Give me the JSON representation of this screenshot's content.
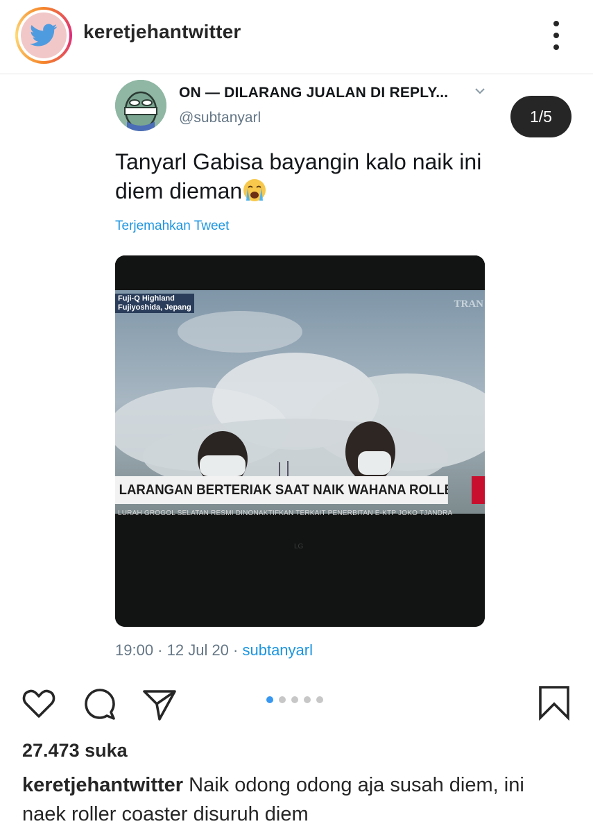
{
  "header": {
    "username": "keretjehantwitter",
    "avatar_icon": "twitter-bird-icon",
    "more_icon": "more-vertical-icon"
  },
  "carousel": {
    "counter": "1/5",
    "dots_total": 5,
    "active_index": 0
  },
  "tweet": {
    "display_name": "ON — DILARANG JUALAN DI REPLY...",
    "handle": "@subtanyarl",
    "text": "Tanyarl Gabisa bayangin kalo naik ini diem dieman",
    "emoji": "loudly-crying-face-icon",
    "translate_label": "Terjemahkan Tweet",
    "time": "19:00",
    "date": "12 Jul 20",
    "source": "subtanyarl",
    "image": {
      "location_line1": "Fuji-Q Highland",
      "location_line2": "Fujiyoshida, Jepang",
      "channel": "TRAN",
      "headline": "LARANGAN BERTERIAK SAAT NAIK WAHANA ROLLER COASTER",
      "ticker": "LURAH GROGOL SELATAN RESMI DINONAKTIFKAN TERKAIT PENERBITAN E-KTP JOKO TJANDRA",
      "brand": "LG"
    }
  },
  "actions": {
    "like_icon": "heart-icon",
    "comment_icon": "comment-icon",
    "share_icon": "send-icon",
    "save_icon": "bookmark-icon"
  },
  "post": {
    "likes": "27.473 suka",
    "caption_user": "keretjehantwitter",
    "caption_text": " Naik odong odong aja susah diem, ini naek roller coaster disuruh diem"
  },
  "colors": {
    "link_blue": "#1b95e0",
    "dot_active": "#3897f0",
    "dot_inactive": "#c7c7c7",
    "counter_bg": "#262626"
  }
}
